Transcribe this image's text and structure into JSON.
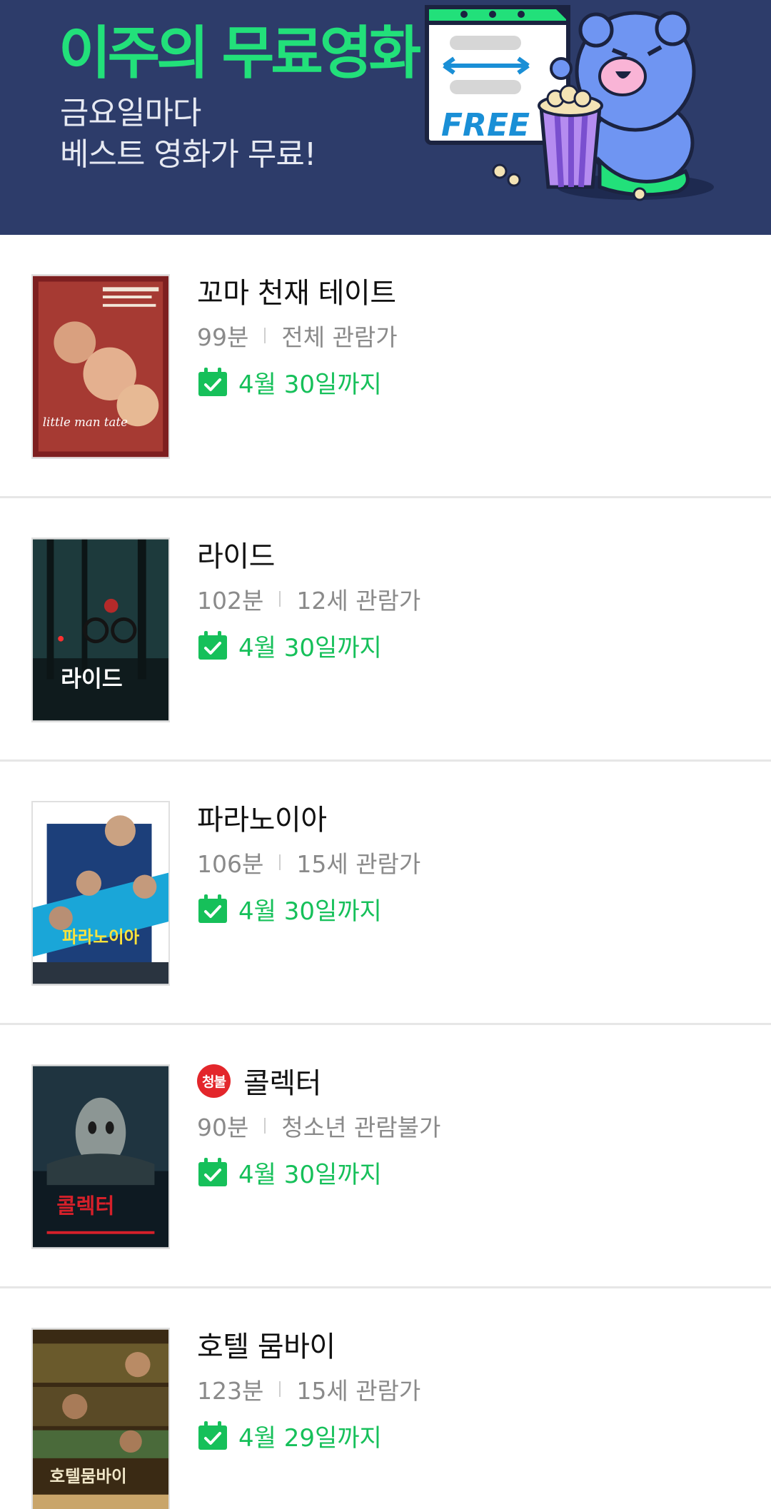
{
  "banner": {
    "title": "이주의 무료영화",
    "subtitle_line1": "금요일마다",
    "subtitle_line2": "베스트 영화가 무료!",
    "free_label": "FREE",
    "colors": {
      "background": "#2d3c6a",
      "title": "#22e07a"
    }
  },
  "movies": [
    {
      "title": "꼬마 천재 테이트",
      "runtime": "99분",
      "rating": "전체 관람가",
      "available_until": "4월 30일까지",
      "adult": false,
      "poster_text": "little man tate"
    },
    {
      "title": "라이드",
      "runtime": "102분",
      "rating": "12세 관람가",
      "available_until": "4월 30일까지",
      "adult": false,
      "poster_text": "라이드"
    },
    {
      "title": "파라노이아",
      "runtime": "106분",
      "rating": "15세 관람가",
      "available_until": "4월 30일까지",
      "adult": false,
      "poster_text": "파라노이아"
    },
    {
      "title": "콜렉터",
      "runtime": "90분",
      "rating": "청소년 관람불가",
      "available_until": "4월 30일까지",
      "adult": true,
      "badge_label": "청불",
      "poster_text": "콜렉터"
    },
    {
      "title": "호텔 뭄바이",
      "runtime": "123분",
      "rating": "15세 관람가",
      "available_until": "4월 29일까지",
      "adult": false,
      "poster_text": "호텔뭄바이"
    }
  ],
  "colors": {
    "available": "#16c05a",
    "adult_badge": "#e3262b"
  },
  "icons": {
    "available": "calendar-check-icon",
    "adult": "adult-only-badge"
  }
}
